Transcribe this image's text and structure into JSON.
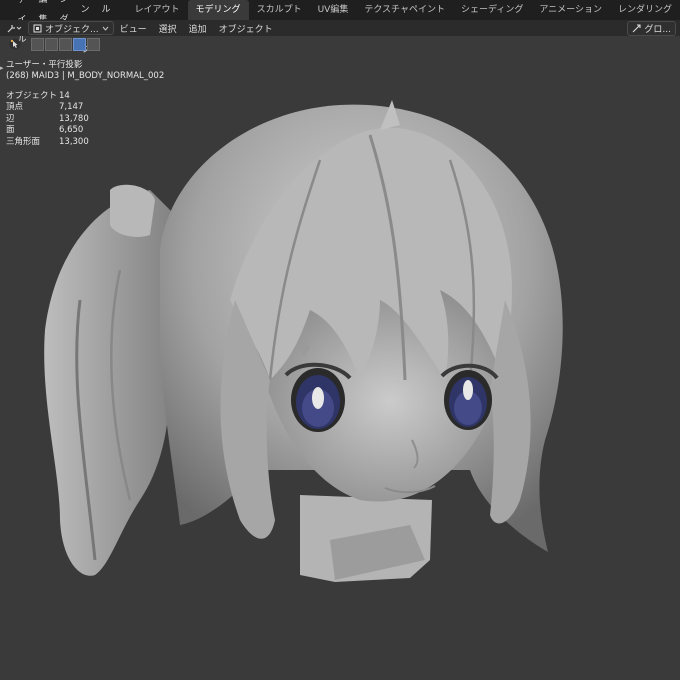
{
  "menubar": {
    "items": [
      "ファイル",
      "編集",
      "レンダー",
      "ウィンドウ",
      "ヘルプ"
    ],
    "workspaces": [
      "レイアウト",
      "モデリング",
      "スカルプト",
      "UV編集",
      "テクスチャペイント",
      "シェーディング",
      "アニメーション",
      "レンダリング"
    ],
    "active_workspace": "モデリング"
  },
  "header": {
    "mode_label": "オブジェク...",
    "menus": [
      "ビュー",
      "選択",
      "追加",
      "オブジェクト"
    ],
    "transform_orientation": "グロ..."
  },
  "overlay": {
    "view_name": "ユーザー・平行投影",
    "object_info": "(268) MAID3 | M_BODY_NORMAL_002"
  },
  "stats": [
    {
      "label": "オブジェクト",
      "value": "14"
    },
    {
      "label": "頂点",
      "value": "7,147"
    },
    {
      "label": "辺",
      "value": "13,780"
    },
    {
      "label": "面",
      "value": "6,650"
    },
    {
      "label": "三角形面",
      "value": "13,300"
    }
  ],
  "colors": {
    "viewport_bg": "#3a3a3a",
    "topbar_bg": "#1f1f1f",
    "header_bg": "#2b2b2b",
    "accent": "#4772b3",
    "model_grey": "#a8a8a8",
    "eye_iris": "#2f3566"
  },
  "icons": {
    "app": "blender-logo-icon",
    "cursor_tool": "select-cursor-icon",
    "object_mode": "object-mode-icon",
    "global": "globe-icon"
  }
}
